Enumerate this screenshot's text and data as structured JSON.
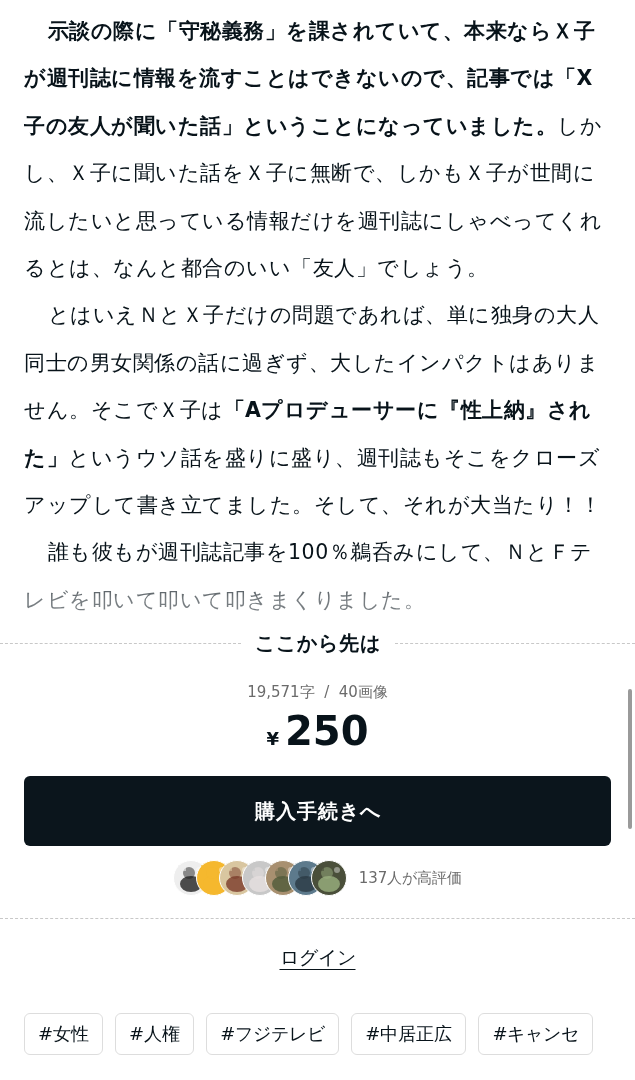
{
  "article": {
    "paragraphs": [
      "**示談の際に「守秘義務」を課されていて、本来ならＸ子が週刊誌に情報を流すことはできないので、記事では「X子の友人が聞いた話」ということになっていました。**しかし、Ｘ子に聞いた話をＸ子に無断で、しかもＸ子が世間に流したいと思っている情報だけを週刊誌にしゃべってくれるとは、なんと都合のいい「友人」でしょう。",
      "とはいえＮとＸ子だけの問題であれば、単に独身の大人同士の男女関係の話に過ぎず、大したインパクトはありません。そこでＸ子は**「Aプロデューサーに『性上納』された」**というウソ話を盛りに盛り、週刊誌もそこをクローズアップして書き立てました。そして、それが大当たり！！",
      "誰も彼もが週刊誌記事を100％鵜呑みにして、ＮとＦテレビを叩いて叩いて叩きまくりました。"
    ]
  },
  "paywall": {
    "heading": "ここから先は",
    "counts": "19,571字  /  40画像",
    "currency": "¥",
    "price": "250",
    "buy_button": "購入手続きへ",
    "likes": "137人が高評価"
  },
  "login_link": "ログイン",
  "tags": [
    "#女性",
    "#人権",
    "#フジテレビ",
    "#中居正広",
    "#キャンセ"
  ]
}
